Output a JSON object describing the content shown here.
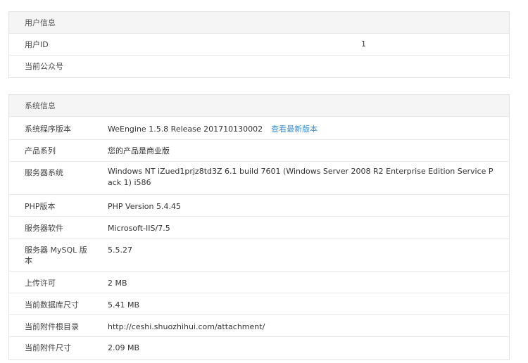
{
  "user_info": {
    "heading": "用户信息",
    "rows": [
      {
        "label": "用户ID",
        "value": "1"
      },
      {
        "label": "当前公众号",
        "value": ""
      }
    ]
  },
  "system_info": {
    "heading": "系统信息",
    "rows": [
      {
        "label": "系统程序版本",
        "value": "WeEngine 1.5.8 Release 201710130002",
        "link": "查看最新版本"
      },
      {
        "label": "产品系列",
        "value": "您的产品是商业版"
      },
      {
        "label": "服务器系统",
        "value": "Windows NT iZued1prjz8td3Z 6.1 build 7601 (Windows Server 2008 R2 Enterprise Edition Service Pack 1) i586"
      },
      {
        "label": "PHP版本",
        "value": "PHP Version 5.4.45"
      },
      {
        "label": "服务器软件",
        "value": "Microsoft-IIS/7.5"
      },
      {
        "label": "服务器 MySQL 版本",
        "value": "5.5.27"
      },
      {
        "label": "上传许可",
        "value": "2 MB"
      },
      {
        "label": "当前数据库尺寸",
        "value": "5.41 MB"
      },
      {
        "label": "当前附件根目录",
        "value": "http://ceshi.shuozhihui.com/attachment/"
      },
      {
        "label": "当前附件尺寸",
        "value": "2.09 MB"
      }
    ]
  },
  "colors": {
    "link": "#3c8fd3",
    "heading_bg": "#f5f5f5",
    "border": "#e3e3e3"
  }
}
